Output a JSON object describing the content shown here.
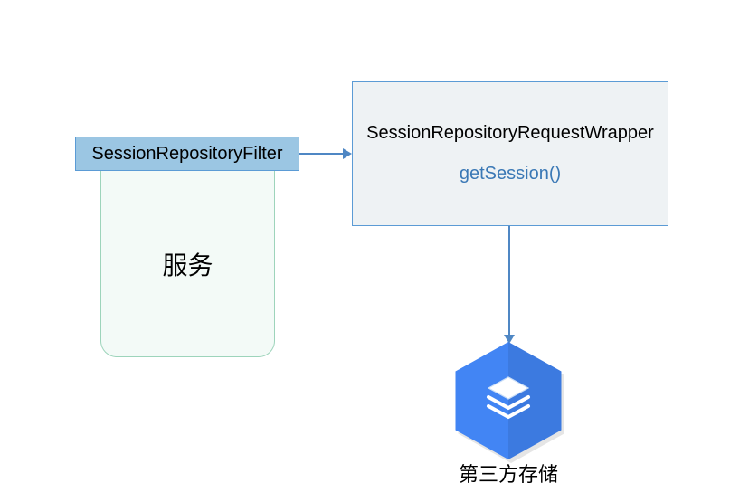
{
  "filter": {
    "label": "SessionRepositoryFilter"
  },
  "service": {
    "label": "服务"
  },
  "wrapper": {
    "title": "SessionRepositoryRequestWrapper",
    "method": "getSession()"
  },
  "storage": {
    "label": "第三方存储"
  }
}
